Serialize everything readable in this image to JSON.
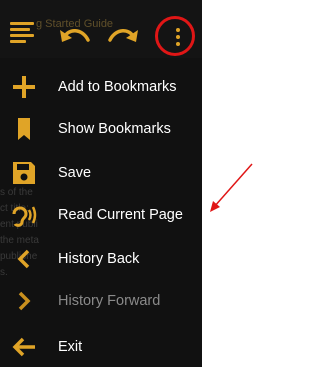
{
  "toolbar": {
    "title": "g Started Guide"
  },
  "menu": {
    "items": [
      {
        "label": "Add to Bookmarks",
        "icon": "plus-icon"
      },
      {
        "label": "Show Bookmarks",
        "icon": "bookmark-icon"
      },
      {
        "label": "Save",
        "icon": "save-icon"
      },
      {
        "label": "Read Current Page",
        "icon": "read-aloud-icon"
      },
      {
        "label": "History Back",
        "icon": "chevron-left-icon"
      },
      {
        "label": "History Forward",
        "icon": "chevron-right-icon",
        "disabled": true
      },
      {
        "label": "Exit",
        "icon": "arrow-left-icon"
      }
    ]
  },
  "background": {
    "lines": [
      "s of the",
      "ct title:",
      "ent publi",
      "the meta",
      "publishe",
      "s."
    ]
  },
  "colors": {
    "accent": "#e0a427",
    "annotation": "#e01616",
    "menu_bg": "#111111"
  }
}
